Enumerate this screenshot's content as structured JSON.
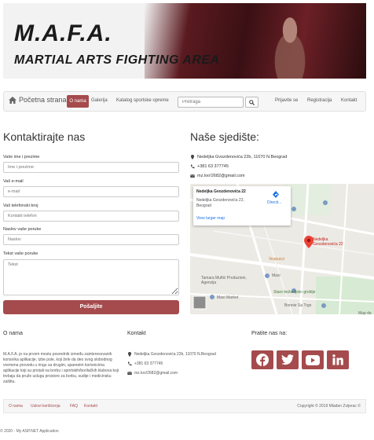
{
  "banner": {
    "title": "M.A.F.A.",
    "subtitle": "MARTIAL ARTS FIGHTING AREA"
  },
  "nav": {
    "brand": "Početna strana",
    "items": [
      "O nama",
      "Galerija",
      "Katalog sportske opreme"
    ],
    "search_placeholder": "Pretraga",
    "right_items": [
      "Prijavite se",
      "Registracija",
      "Kontakt"
    ]
  },
  "contact": {
    "heading": "Kontaktirajte nas",
    "fields": [
      {
        "label": "Vaše ime i prezime",
        "placeholder": "Ime i prezime"
      },
      {
        "label": "Vaš e-mail",
        "placeholder": "e-mail"
      },
      {
        "label": "Vaš telefonski broj",
        "placeholder": "Kontakt telefon"
      },
      {
        "label": "Naslov vaše poruke",
        "placeholder": "Naslov"
      }
    ],
    "message_label": "Tekst vaše poruke",
    "message_placeholder": "Tekst",
    "submit_label": "Pošaljite"
  },
  "hq": {
    "heading": "Naše sjedište:",
    "address": "Nedeljka Gvozdenovića 22b, 11070 N.Beograd",
    "phone": "+381 63 377745",
    "email": "mz.loo!2682@gmail.com"
  },
  "map": {
    "card_title": "Nedeljka Gvozdenovića 22",
    "card_address": "Nedeljka Gvozdenovića 22, Beograd",
    "card_link": "View larger map",
    "directions": "Directi...",
    "pin_label_1": "Nedeljka",
    "pin_label_2": "Gvozdenovića 22",
    "labels": [
      "Vespucci",
      "Maxi",
      "Tamara Muftić Produzioni, Agenzija",
      "Staro bežanijsko groblje",
      "Maxi Market",
      "Bonnie Sa Trgo",
      "Map da"
    ]
  },
  "footer": {
    "about_heading": "O nama",
    "about_text": "M.A.F.A. je na prvom mestu posrednik između zainteresovanih korisnika aplikacije, tzbe pole, koji žele da deo svog slobodnog vremena provedu u ringu sa drugim, upareeim korisnicima aplikacije koji su pristali na borbu i sportskih/borilačkih klubova koji trebaju da pruže uslugu prostore za borbu, sudije i medicinsku zaštitu.",
    "contact_heading": "Kontakt",
    "contact_address": "Nedeljka Gvozdenovića 22b, 11070 N.Beograd",
    "contact_phone": "+381 63 377745",
    "contact_email": "mz.loo!2682@gmail.com",
    "follow_heading": "Pratite nas na:",
    "social": [
      "facebook-icon",
      "twitter-icon",
      "youtube-icon",
      "linkedin-icon"
    ],
    "links": [
      "O nama",
      "Uslovi korišćenja",
      "FAQ",
      "Kontakt"
    ],
    "copyright": "Copyright © 2019 Mladen Zvijerac ©",
    "app_copyright": "© 2020 - My ASP.NET Application"
  },
  "colors": {
    "accent": "#a54b4d"
  }
}
